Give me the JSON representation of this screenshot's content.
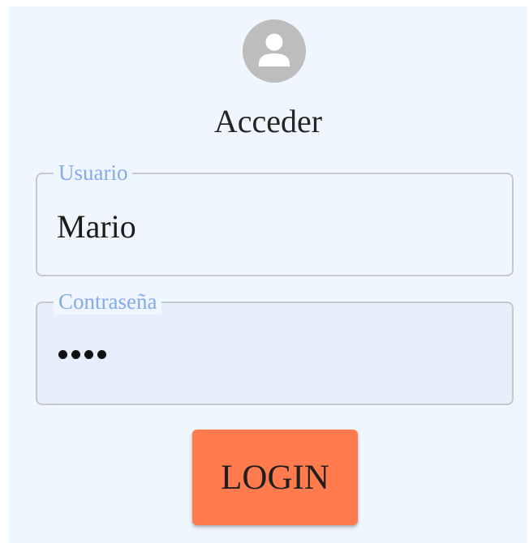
{
  "login_form": {
    "avatar_icon": "account-circle-icon",
    "title": "Acceder",
    "username": {
      "label": "Usuario",
      "value": "Mario"
    },
    "password": {
      "label": "Contraseña",
      "masked_length": 4
    },
    "submit_label": "LOGIN"
  },
  "colors": {
    "card_background": "#f0f6fe",
    "label_color": "#84aaee",
    "button_background": "#ff7b4d",
    "avatar_background": "#bdbdbd"
  }
}
